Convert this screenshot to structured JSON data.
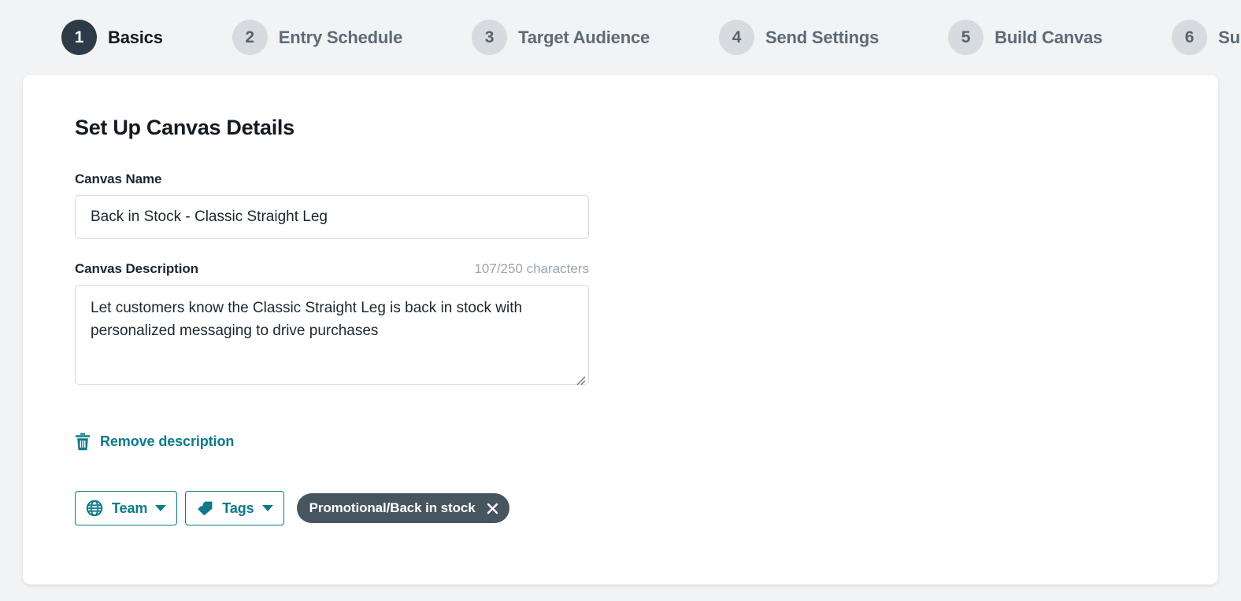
{
  "stepper": {
    "steps": [
      {
        "number": "1",
        "label": "Basics",
        "active": true
      },
      {
        "number": "2",
        "label": "Entry Schedule",
        "active": false
      },
      {
        "number": "3",
        "label": "Target Audience",
        "active": false
      },
      {
        "number": "4",
        "label": "Send Settings",
        "active": false
      },
      {
        "number": "5",
        "label": "Build Canvas",
        "active": false
      },
      {
        "number": "6",
        "label": "Summary",
        "active": false
      }
    ]
  },
  "main": {
    "title": "Set Up Canvas Details",
    "canvas_name": {
      "label": "Canvas Name",
      "value": "Back in Stock - Classic Straight Leg",
      "placeholder": "Canvas Name"
    },
    "canvas_description": {
      "label": "Canvas Description",
      "char_count": "107/250 characters",
      "value": "Let customers know the Classic Straight Leg is back in stock with personalized messaging to drive purchases",
      "placeholder": "Canvas Description"
    },
    "remove_description": {
      "label": "Remove description",
      "icon": "trash-icon"
    },
    "team_button": {
      "label": "Team",
      "icon": "globe-icon",
      "caret": "chevron-down-icon"
    },
    "tags_button": {
      "label": "Tags",
      "icon": "tag-icon",
      "caret": "chevron-down-icon"
    },
    "tag_chips": [
      {
        "label": "Promotional/Back in stock",
        "remove_icon": "close-icon"
      }
    ]
  },
  "colors": {
    "page_background": "#f2f3f5",
    "card_background": "#ffffff",
    "accent_teal": "#0a7a8c",
    "step_active": "#2c3b47",
    "step_inactive": "#d7dbdf",
    "chip_background": "#47555f",
    "muted_text": "#9aa5ae"
  }
}
